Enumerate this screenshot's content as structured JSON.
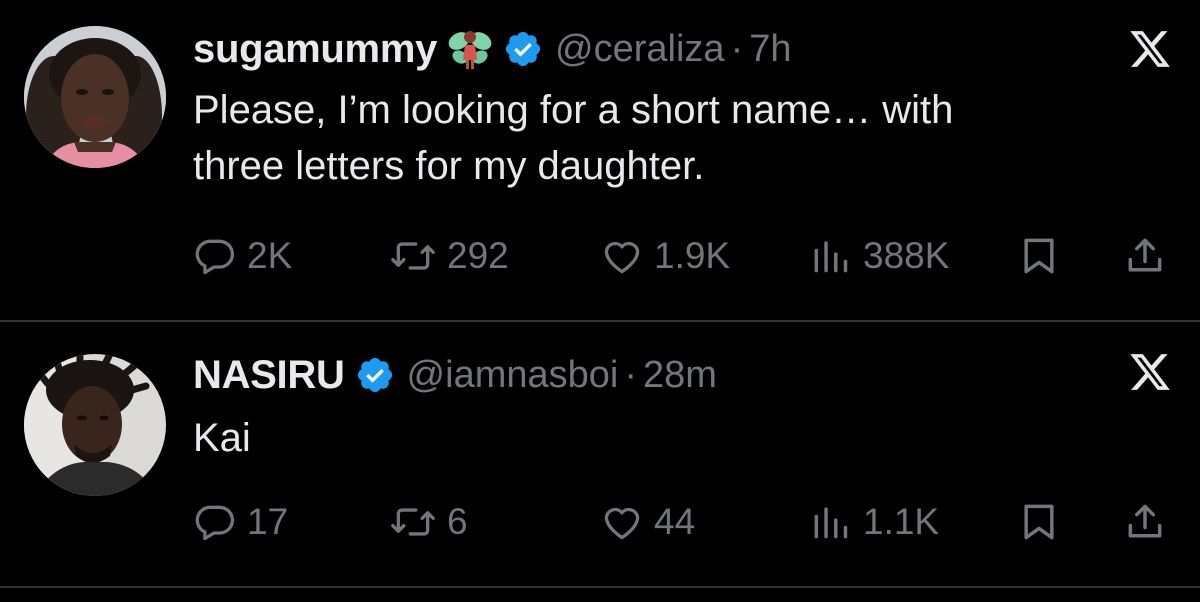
{
  "tweets": [
    {
      "display_name": "sugamummy",
      "name_emoji": "fairy-emoji",
      "verified_icon": "verified-badge-icon",
      "handle": "@ceraliza",
      "separator": "·",
      "time": "7h",
      "text_lines": [
        "Please, I’m looking for a short name… with",
        "three letters for my daughter."
      ],
      "stats": {
        "replies": "2K",
        "reposts": "292",
        "likes": "1.9K",
        "views": "388K"
      }
    },
    {
      "display_name": "NASIRU",
      "verified_icon": "verified-badge-icon",
      "handle": "@iamnasboi",
      "separator": "·",
      "time": "28m",
      "text_lines": [
        "Kai"
      ],
      "stats": {
        "replies": "17",
        "reposts": "6",
        "likes": "44",
        "views": "1.1K"
      }
    }
  ],
  "icons": {
    "platform": "x-logo-icon",
    "reply": "reply-icon",
    "repost": "repost-icon",
    "like": "heart-icon",
    "views": "views-chart-icon",
    "bookmark": "bookmark-icon",
    "share": "share-icon"
  },
  "colors": {
    "background": "#000000",
    "text_primary": "#e7e9ea",
    "text_secondary": "#71767b",
    "verified_blue": "#1d9bf0",
    "divider": "#2f3336"
  }
}
